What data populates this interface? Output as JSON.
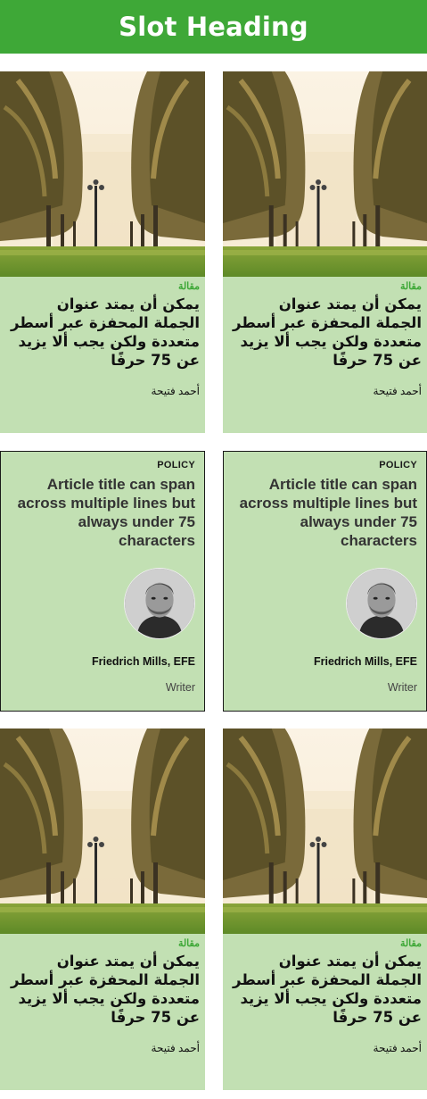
{
  "header": {
    "title": "Slot Heading"
  },
  "image_cards": [
    {
      "category": "مقالة",
      "title": "يمكن أن يمتد عنوان الجملة المحفزة عبر أسطر متعددة ولكن يجب ألا يزيد عن 75 حرفًا",
      "author": "أحمد فتيحة"
    },
    {
      "category": "مقالة",
      "title": "يمكن أن يمتد عنوان الجملة المحفزة عبر أسطر متعددة ولكن يجب ألا يزيد عن 75 حرفًا",
      "author": "أحمد فتيحة"
    },
    {
      "category": "مقالة",
      "title": "يمكن أن يمتد عنوان الجملة المحفزة عبر أسطر متعددة ولكن يجب ألا يزيد عن 75 حرفًا",
      "author": "أحمد فتيحة"
    },
    {
      "category": "مقالة",
      "title": "يمكن أن يمتد عنوان الجملة المحفزة عبر أسطر متعددة ولكن يجب ألا يزيد عن 75 حرفًا",
      "author": "أحمد فتيحة"
    }
  ],
  "text_cards": [
    {
      "category": "POLICY",
      "title": "Article title can span across multiple lines but always under 75 characters",
      "name": "Friedrich Mills, EFE",
      "role": "Writer"
    },
    {
      "category": "POLICY",
      "title": "Article title can span across multiple lines but always under 75 characters",
      "name": "Friedrich Mills, EFE",
      "role": "Writer"
    }
  ],
  "colors": {
    "accent": "#3ea837",
    "card_bg": "#c2e0b3",
    "header_text": "#ffffff"
  }
}
